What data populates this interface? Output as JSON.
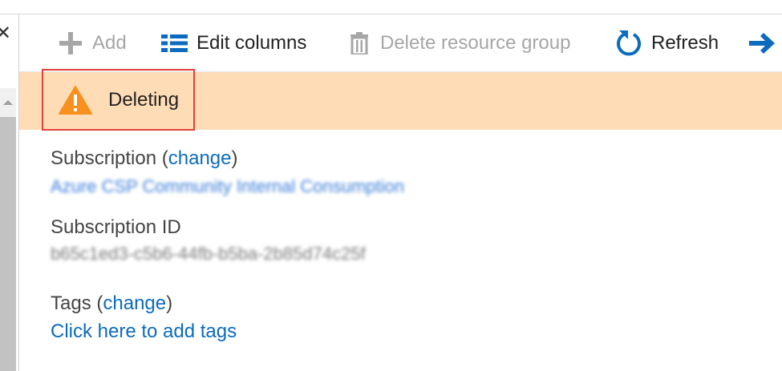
{
  "toolbar": {
    "add_label": "Add",
    "edit_columns_label": "Edit columns",
    "delete_rg_label": "Delete resource group",
    "refresh_label": "Refresh"
  },
  "status": {
    "text": "Deleting"
  },
  "essentials": {
    "subscription": {
      "label": "Subscription",
      "paren_open": " (",
      "change_link": "change",
      "paren_close": ")",
      "value": "Azure CSP Community Internal Consumption"
    },
    "subscription_id": {
      "label": "Subscription ID",
      "value": "b65c1ed3-c5b6-44fb-b5ba-2b85d74c25f"
    },
    "tags": {
      "label": "Tags",
      "paren_open": " (",
      "change_link": "change",
      "paren_close": ")",
      "add_link": "Click here to add tags"
    }
  },
  "colors": {
    "accent": "#0078d4",
    "banner_bg": "#fedcb6",
    "warning": "#f7901e",
    "highlight_border": "#e0413a",
    "link": "#0c6bbe"
  },
  "icons": [
    "close-icon",
    "plus-icon",
    "columns-icon",
    "trash-icon",
    "refresh-icon",
    "arrow-right-icon",
    "warning-icon",
    "scroll-up-icon"
  ]
}
